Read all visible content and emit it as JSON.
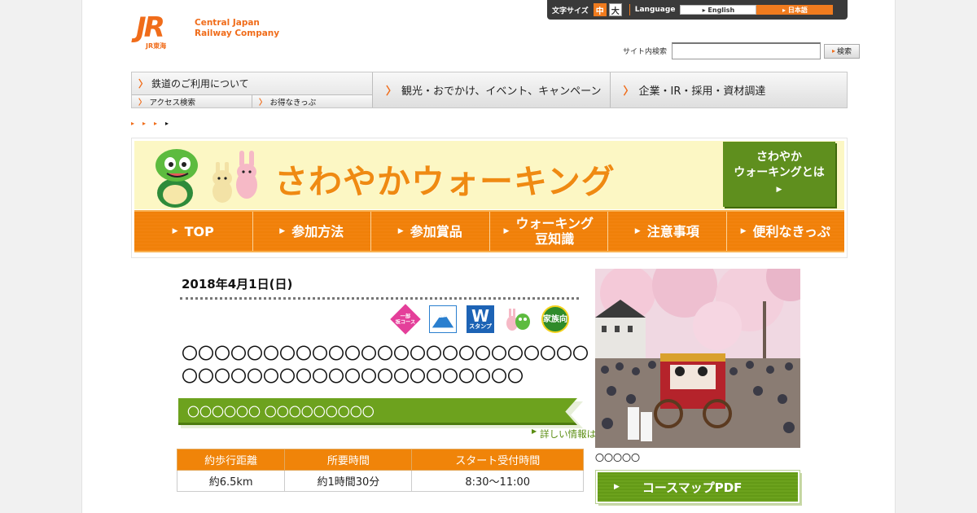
{
  "header": {
    "logo_mark": "JR",
    "logo_sub": "JR東海",
    "company_line1": "Central Japan",
    "company_line2": "Railway Company"
  },
  "topbar": {
    "font_size_label": "文字サイズ",
    "font_mid": "中",
    "font_large": "大",
    "language_label": "Language",
    "english": "English",
    "japanese": "日本語"
  },
  "search": {
    "label": "サイト内検索",
    "placeholder": "",
    "button": "検索"
  },
  "gnav": {
    "rail_label": "鉄道のご利用について",
    "rail_sub1": "アクセス検索",
    "rail_sub2": "お得なきっぷ",
    "item2": "観光・おでかけ、イベント、キャンペーン",
    "item3": "企業・IR・採用・資材調達"
  },
  "banner": {
    "title": "さわやかウォーキング",
    "what_line1": "さわやか",
    "what_line2": "ウォーキングとは",
    "tabs": [
      {
        "label": "TOP"
      },
      {
        "label": "参加方法"
      },
      {
        "label": "参加賞品"
      },
      {
        "label": "ウォーキング\n豆知識"
      },
      {
        "label": "注意事項"
      },
      {
        "label": "便利なきっぷ"
      }
    ]
  },
  "event": {
    "date": "2018年4月1日(日)",
    "badges": {
      "pink": "一部\n坂コース",
      "fuji": "ふじ",
      "stamp_letter": "W",
      "stamp_text": "スタンプ",
      "family": "家族向"
    },
    "title": "〇〇〇〇〇〇〇〇〇〇〇〇〇〇〇〇〇〇〇〇〇〇〇〇〇〇〇〇〇〇〇〇〇〇〇〇〇〇〇〇〇〇〇〇〇〇",
    "course_name": "〇〇〇〇〇〇 〇〇〇〇〇〇〇〇〇",
    "detail_link": "詳しい情報はこちら",
    "table": {
      "headers": [
        "約歩行距離",
        "所要時間",
        "スタート受付時間"
      ],
      "values": [
        "約6.5km",
        "約1時間30分",
        "8:30〜11:00"
      ]
    },
    "photo_caption": "〇〇〇〇〇",
    "pdf_button": "コースマップPDF"
  },
  "colors": {
    "jr_orange": "#f06c1a",
    "tab_orange": "#f3860f",
    "green": "#6da21e"
  }
}
